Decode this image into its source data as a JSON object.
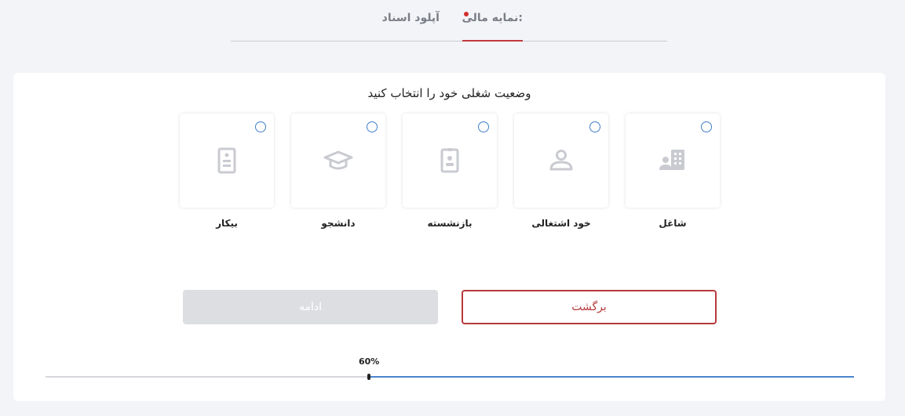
{
  "tabs": [
    {
      "label": "نمایه مالی:",
      "active": true
    },
    {
      "label": "آپلود اسناد",
      "active": false
    }
  ],
  "question": "وضعیت شغلی خود را انتخاب کنید",
  "options": [
    {
      "label": "شاغل",
      "icon": "office-building-user-icon"
    },
    {
      "label": "خود اشتغالی",
      "icon": "person-icon"
    },
    {
      "label": "بازنشسته",
      "icon": "id-badge-icon"
    },
    {
      "label": "دانشجو",
      "icon": "graduation-cap-icon"
    },
    {
      "label": "بیکار",
      "icon": "document-list-icon"
    }
  ],
  "buttons": {
    "back": "برگشت",
    "continue": "ادامه"
  },
  "progress": {
    "label": "60%",
    "value": 0.6
  },
  "colors": {
    "accent_red": "#b6393b",
    "accent_blue": "#4a83cc",
    "disabled": "#dcdee2"
  }
}
